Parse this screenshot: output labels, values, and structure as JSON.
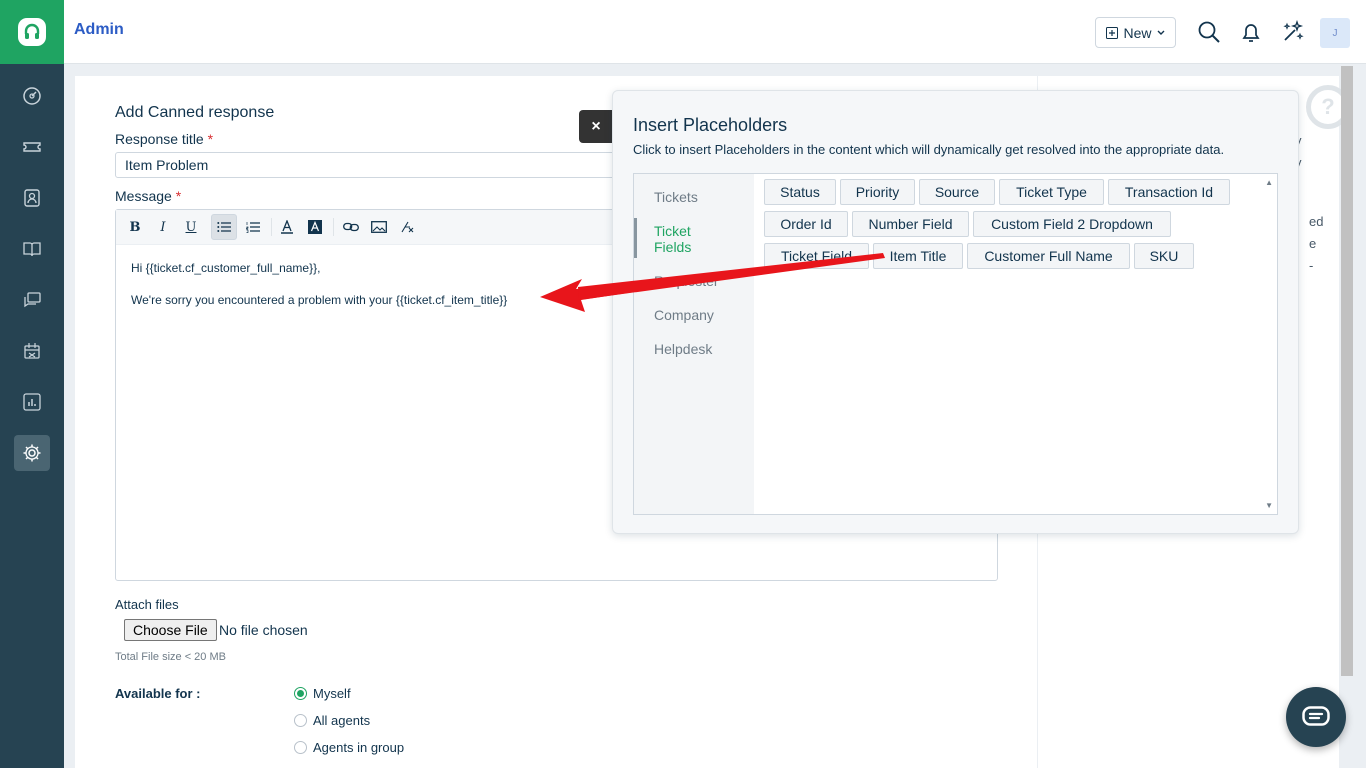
{
  "header": {
    "title": "Admin",
    "new_label": "New"
  },
  "avatar_initial": "J",
  "sidebar": {
    "items": [
      {
        "name": "dashboard-icon"
      },
      {
        "name": "tickets-icon"
      },
      {
        "name": "contacts-icon"
      },
      {
        "name": "solutions-icon"
      },
      {
        "name": "forums-icon"
      },
      {
        "name": "marketplace-icon"
      },
      {
        "name": "reports-icon"
      },
      {
        "name": "admin-gear-icon",
        "active": true
      }
    ]
  },
  "form": {
    "heading": "Add Canned response",
    "response_title_label": "Response title",
    "response_title_value": "Item Problem",
    "message_label": "Message",
    "required_mark": "*",
    "toolbar": [
      "B",
      "I",
      "U",
      "bulleted-list",
      "numbered-list",
      "font-color",
      "background-color",
      "link",
      "image",
      "clear-format"
    ],
    "message_lines": [
      "Hi {{ticket.cf_customer_full_name}},",
      "We're sorry you encountered a problem with your {{ticket.cf_item_title}}"
    ],
    "attach_label": "Attach files",
    "choose_file_label": "Choose File",
    "no_file_text": "No file chosen",
    "size_note": "Total File size < 20 MB",
    "available_label": "Available for :",
    "availability_options": [
      {
        "label": "Myself",
        "checked": true
      },
      {
        "label": "All agents",
        "checked": false
      },
      {
        "label": "Agents in group",
        "checked": false
      }
    ]
  },
  "right_fragments": [
    "y",
    "y",
    "ed",
    "e",
    "-"
  ],
  "help_mark": "?",
  "popup": {
    "close_label": "×",
    "title": "Insert Placeholders",
    "description": "Click to insert Placeholders in the content which will dynamically get resolved into the appropriate data.",
    "tabs": [
      {
        "label": "Tickets",
        "active": false
      },
      {
        "label": "Ticket Fields",
        "active": true
      },
      {
        "label": "Requester",
        "active": false
      },
      {
        "label": "Company",
        "active": false
      },
      {
        "label": "Helpdesk",
        "active": false
      }
    ],
    "chips": [
      "Status",
      "Priority",
      "Source",
      "Ticket Type",
      "Transaction Id",
      "Order Id",
      "Number Field",
      "Custom Field 2 Dropdown",
      "Ticket Field",
      "Item Title",
      "Customer Full Name",
      "SKU"
    ]
  },
  "colors": {
    "sidebar": "#264352",
    "brand_green": "#1fa462",
    "link_blue": "#2c5cc5",
    "annotation_arrow": "#e8151b"
  }
}
